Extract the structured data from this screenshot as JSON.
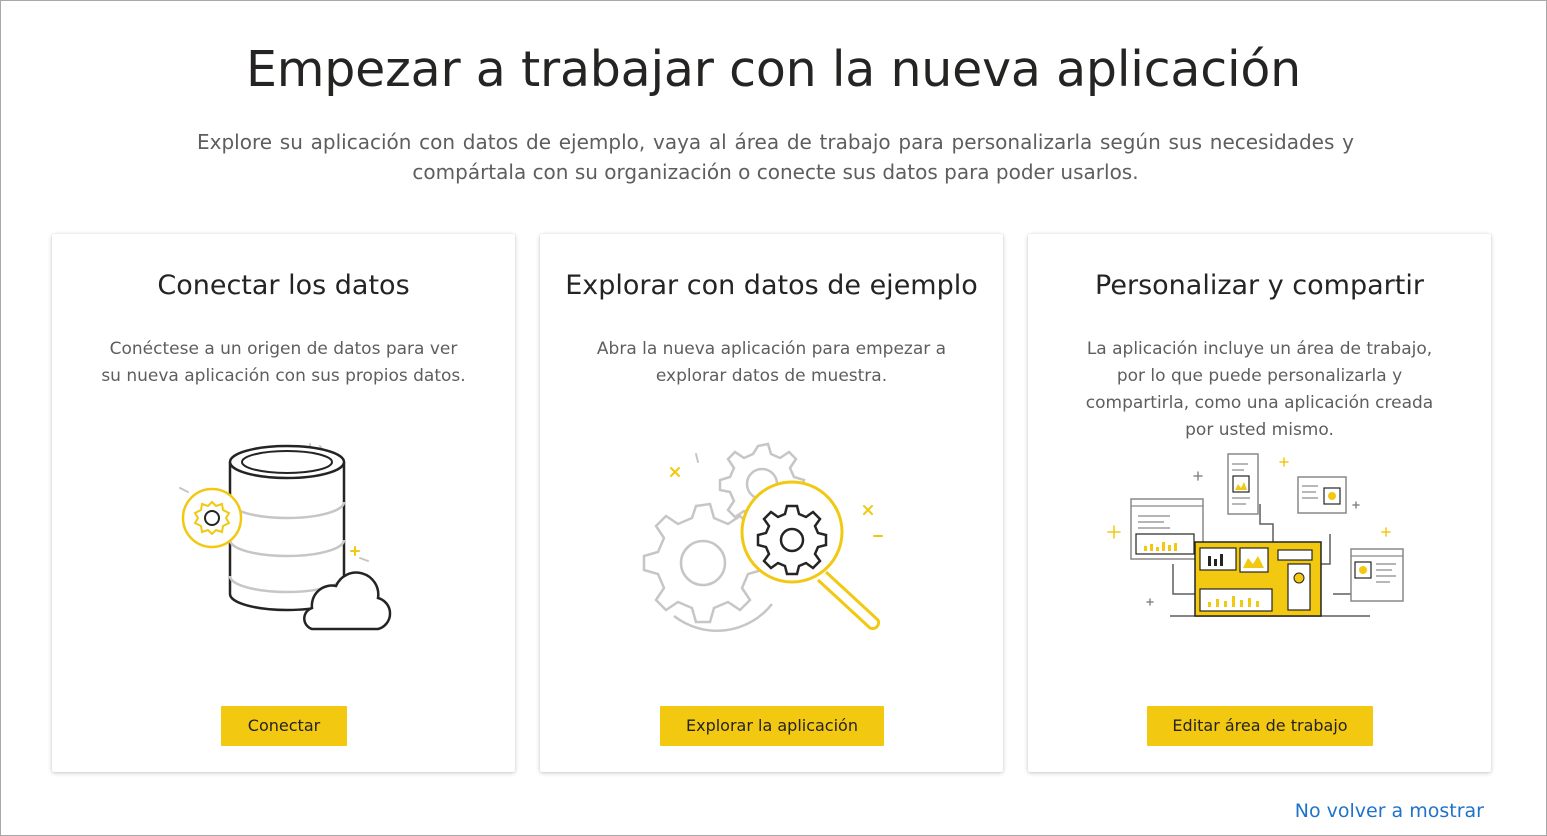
{
  "header": {
    "title": "Empezar a trabajar con la nueva aplicación",
    "subtitle": "Explore su aplicación con datos de ejemplo, vaya al área de trabajo para personalizarla según sus necesidades y compártala con su organización o conecte sus datos para poder usarlos."
  },
  "cards": [
    {
      "title": "Conectar los datos",
      "description": "Conéctese a un origen de datos para ver su nueva aplicación con sus propios datos.",
      "button_label": "Conectar",
      "illustration": "database-cloud-icon"
    },
    {
      "title": "Explorar con datos de ejemplo",
      "description": "Abra la nueva aplicación para empezar a explorar datos de muestra.",
      "button_label": "Explorar la aplicación",
      "illustration": "gears-magnifier-icon"
    },
    {
      "title": "Personalizar y compartir",
      "description": "La aplicación incluye un área de trabajo, por lo que puede personalizarla y compartirla, como una aplicación creada por usted mismo.",
      "button_label": "Editar área de trabajo",
      "illustration": "dashboard-share-icon"
    }
  ],
  "footer": {
    "dismiss_link": "No volver a mostrar"
  },
  "colors": {
    "accent": "#f2c811",
    "title_text": "#252423",
    "body_text": "#605e5c",
    "link": "#1f73c8",
    "line_gray": "#c8c6c4",
    "line_dark": "#252423"
  }
}
